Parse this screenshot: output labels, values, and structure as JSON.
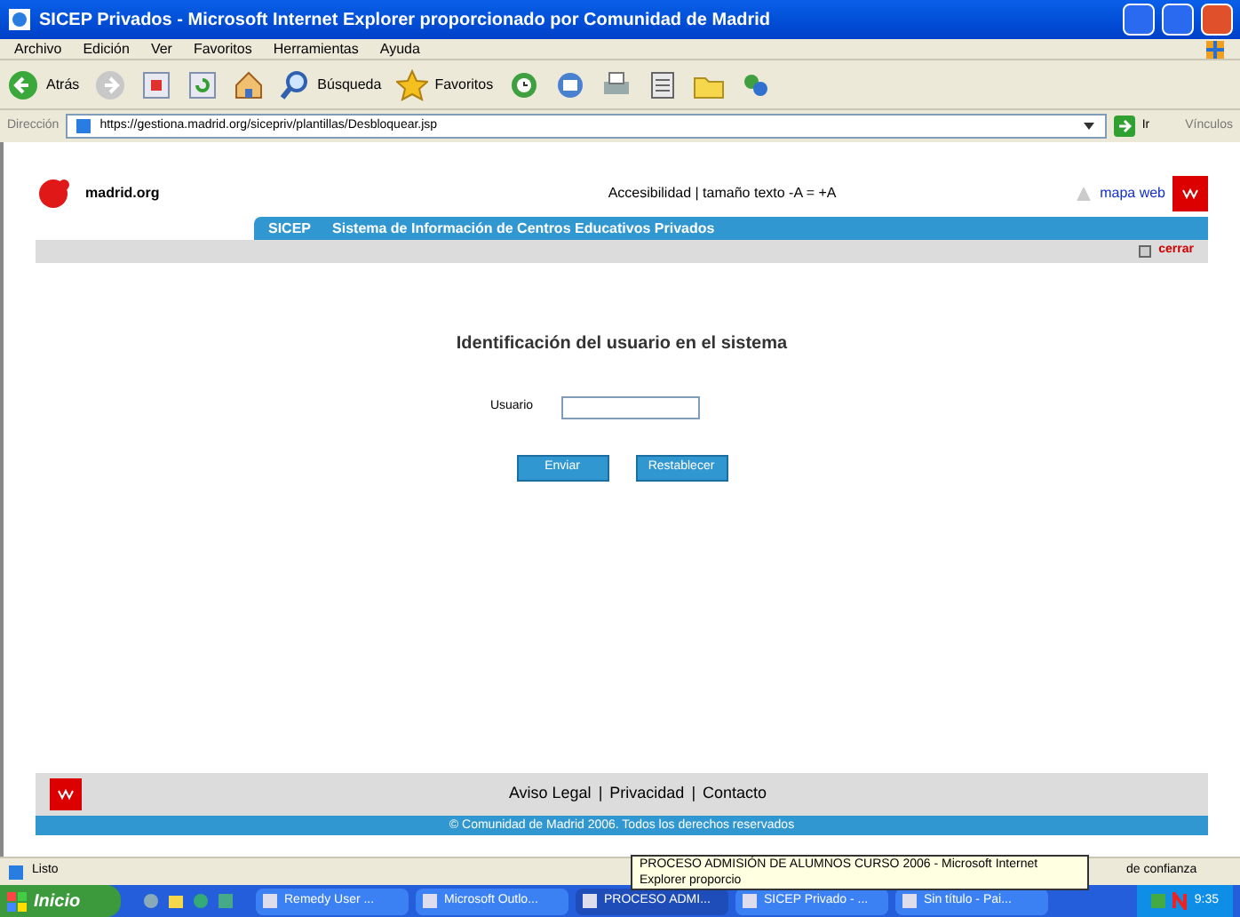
{
  "window": {
    "title": "SICEP Privados - Microsoft Internet Explorer proporcionado por Comunidad de Madrid"
  },
  "menu": [
    "Archivo",
    "Edición",
    "Ver",
    "Favoritos",
    "Herramientas",
    "Ayuda"
  ],
  "toolbar": [
    {
      "kind": "back",
      "label": "Atrás"
    },
    {
      "kind": "forward"
    },
    {
      "kind": "stop"
    },
    {
      "kind": "refresh"
    },
    {
      "kind": "home"
    },
    {
      "kind": "search",
      "label": "Búsqueda"
    },
    {
      "kind": "favorites",
      "label": "Favoritos"
    },
    {
      "kind": "history"
    },
    {
      "kind": "mail"
    },
    {
      "kind": "print"
    },
    {
      "kind": "edit"
    },
    {
      "kind": "folder"
    },
    {
      "kind": "messenger"
    }
  ],
  "address_bar": {
    "label": "Dirección",
    "url": "https://gestiona.madrid.org/sicepriv/plantillas/Desbloquear.jsp",
    "go": "Ir",
    "links": "Vínculos"
  },
  "site_header": {
    "logo": "madrid.org",
    "accessibility": "Accesibilidad | tamaño texto  -A  =  +A",
    "site_map": "mapa web"
  },
  "nav_bar": {
    "acronym": "SICEP",
    "title": "Sistema de Información de Centros Educativos Privados"
  },
  "logout": "cerrar",
  "form": {
    "heading": "Identificación del usuario en el sistema",
    "user_label": "Usuario",
    "buttons": [
      "Enviar",
      "Restablecer"
    ]
  },
  "footer": {
    "links": [
      "Aviso Legal",
      "Privacidad",
      "Contacto"
    ],
    "separator": "|",
    "copyright": "© Comunidad de Madrid 2006. Todos los derechos reservados"
  },
  "status_bar": {
    "text": "Listo",
    "zone": "de confianza"
  },
  "tooltip": "PROCESO ADMISIÓN DE ALUMNOS CURSO 2006 - Microsoft Internet Explorer proporcio",
  "taskbar": {
    "start": "Inicio",
    "tasks": [
      {
        "label": "Remedy User ...",
        "selected": false
      },
      {
        "label": "Microsoft Outlo...",
        "selected": false
      },
      {
        "label": "PROCESO ADMI...",
        "selected": true
      },
      {
        "label": "SICEP Privado - ...",
        "selected": false
      },
      {
        "label": "Sin título - Pai...",
        "selected": false
      }
    ],
    "clock": "9:35"
  }
}
